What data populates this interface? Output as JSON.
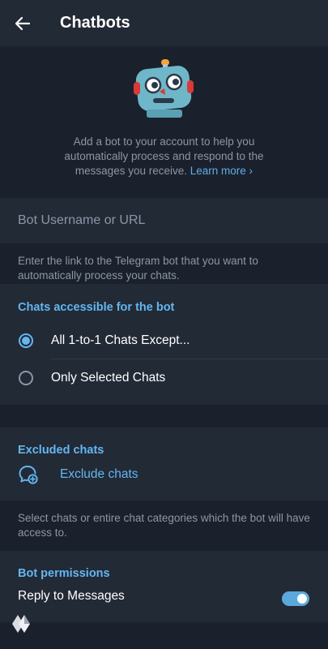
{
  "header": {
    "title": "Chatbots",
    "back_icon": "arrow-left-icon"
  },
  "hero": {
    "illustration": "robot-sticker",
    "description": "Add a bot to your account to help you automatically process and respond to the messages you receive.",
    "learn_more": "Learn more ›"
  },
  "bot_input": {
    "placeholder": "Bot Username or URL",
    "value": "",
    "hint": "Enter the link to the Telegram bot that you want to automatically process your chats."
  },
  "access": {
    "header": "Chats accessible for the bot",
    "options": [
      {
        "label": "All 1-to-1 Chats Except...",
        "selected": true
      },
      {
        "label": "Only Selected Chats",
        "selected": false
      }
    ]
  },
  "excluded": {
    "header": "Excluded chats",
    "action_label": "Exclude chats",
    "action_icon": "add-chat-icon",
    "hint": "Select chats or entire chat categories which the bot will have access to."
  },
  "permissions": {
    "header": "Bot permissions",
    "reply_label": "Reply to Messages",
    "reply_enabled": true
  },
  "colors": {
    "accent": "#63b6f0",
    "background": "#1b212c",
    "card": "#222a36",
    "muted_text": "#8c96a6"
  }
}
